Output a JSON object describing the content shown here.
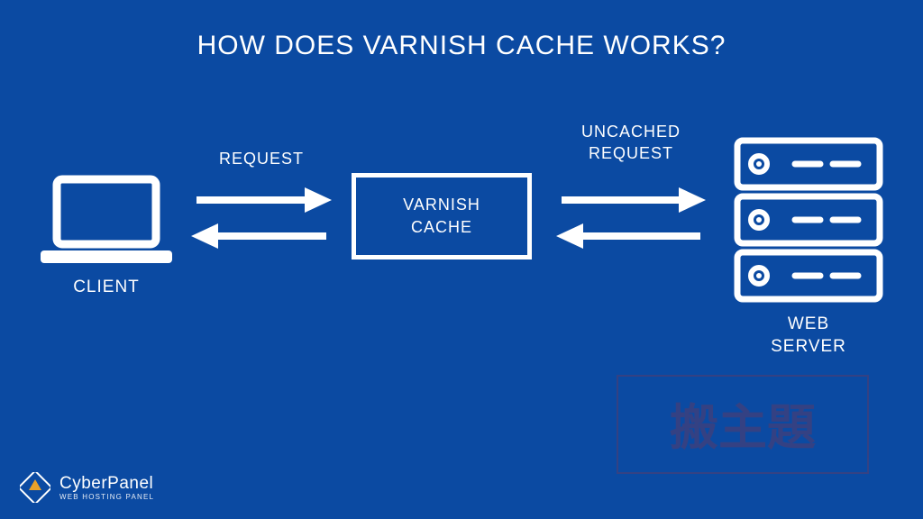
{
  "title": "HOW DOES VARNISH CACHE WORKS?",
  "nodes": {
    "client": {
      "label": "CLIENT"
    },
    "cache": {
      "label_line1": "VARNISH",
      "label_line2": "CACHE"
    },
    "server": {
      "label_line1": "WEB",
      "label_line2": "SERVER"
    }
  },
  "arrows": {
    "client_to_cache": {
      "label": "REQUEST"
    },
    "cache_to_server": {
      "label_line1": "UNCACHED",
      "label_line2": "REQUEST"
    }
  },
  "brand": {
    "name": "CyberPanel",
    "tagline": "WEB HOSTING PANEL"
  },
  "watermark": {
    "text": "搬主題",
    "sub": ""
  },
  "colors": {
    "bg": "#0b4aa2",
    "fg": "#ffffff",
    "watermark": "#b02a2a"
  }
}
